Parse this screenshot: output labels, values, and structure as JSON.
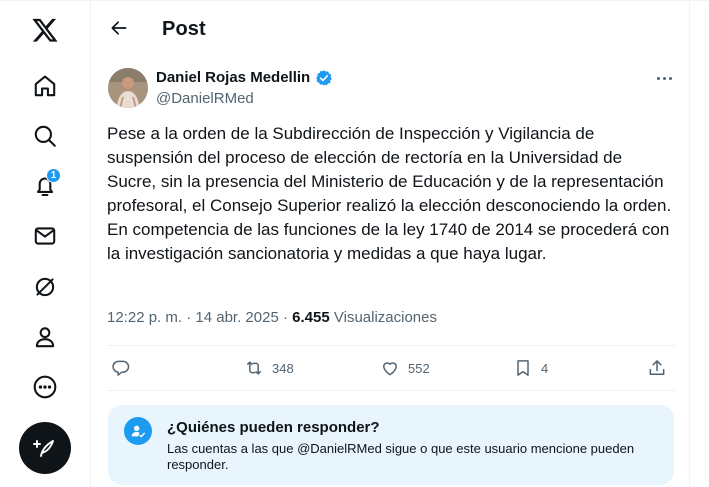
{
  "sidebar": {
    "items": [
      {
        "name": "x-logo-icon"
      },
      {
        "name": "home-icon"
      },
      {
        "name": "search-icon"
      },
      {
        "name": "notifications-icon",
        "badge": "1"
      },
      {
        "name": "messages-icon"
      },
      {
        "name": "grok-icon"
      },
      {
        "name": "profile-icon"
      },
      {
        "name": "more-icon"
      }
    ],
    "compose_icon": "compose-icon"
  },
  "header": {
    "title": "Post",
    "back_icon": "arrow-left-icon"
  },
  "post": {
    "author_name": "Daniel Rojas Medellin",
    "handle": "@DanielRMed",
    "verified": true,
    "paragraph1": "Pese a la orden de la Subdirección de Inspección y Vigilancia de suspensión del proceso de elección de rectoría en la Universidad de Sucre, sin la presencia del Ministerio de Educación y de la representación profesoral, el Consejo Superior realizó la elección desconociendo la orden.",
    "paragraph2": "En competencia de las funciones de la ley 1740 de 2014 se procederá con la investigación sancionatoria y medidas a que haya lugar.",
    "time": "12:22 p. m.",
    "dot": "·",
    "date": "14 abr. 2025",
    "views_count": "6.455",
    "views_label": "Visualizaciones",
    "actions": {
      "reply_count": "",
      "repost_count": "348",
      "like_count": "552",
      "bookmark_count": "4"
    }
  },
  "reply_restriction": {
    "title": "¿Quiénes pueden responder?",
    "description": "Las cuentas a las que @DanielRMed sigue o que este usuario mencione pueden responder."
  },
  "colors": {
    "accent": "#1d9bf0",
    "text": "#0f1419",
    "secondary": "#536471",
    "info_bg": "#e8f5fd"
  }
}
